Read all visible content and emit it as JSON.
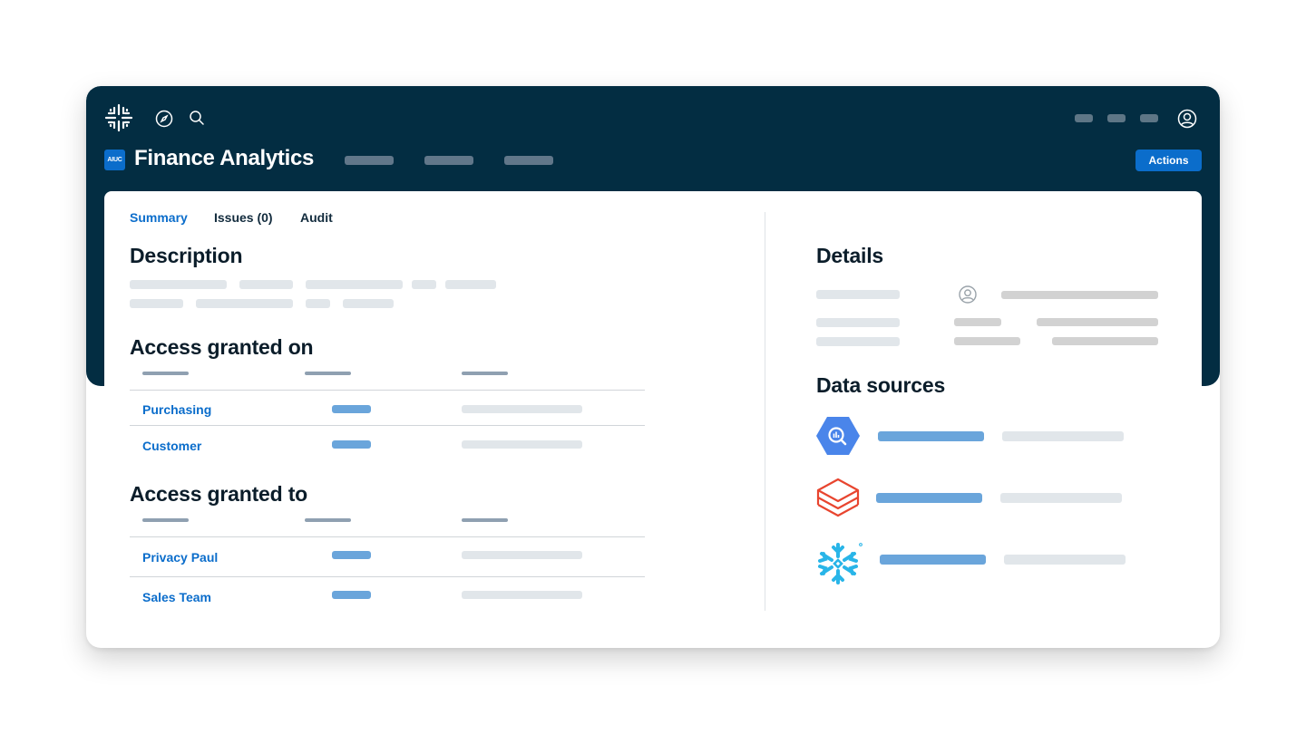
{
  "header": {
    "app_badge": "AIUC",
    "title": "Finance Analytics",
    "actions_label": "Actions"
  },
  "tabs": [
    {
      "label": "Summary",
      "active": true
    },
    {
      "label": "Issues (0)",
      "active": false
    },
    {
      "label": "Audit",
      "active": false
    }
  ],
  "sections": {
    "description_title": "Description",
    "access_on_title": "Access granted on",
    "access_to_title": "Access granted to",
    "details_title": "Details",
    "data_sources_title": "Data sources"
  },
  "access_granted_on": {
    "rows": [
      "Purchasing",
      "Customer"
    ]
  },
  "access_granted_to": {
    "rows": [
      "Privacy Paul",
      "Sales Team"
    ]
  },
  "data_sources": [
    {
      "icon": "bigquery-icon",
      "color": "#4a85ea"
    },
    {
      "icon": "databricks-icon",
      "color": "#e8452f"
    },
    {
      "icon": "snowflake-icon",
      "color": "#29b5e8"
    }
  ],
  "colors": {
    "header_bg": "#032d42",
    "accent": "#0b6dcb",
    "placeholder_blue": "#6aa5db",
    "placeholder_gray": "#e1e6ea"
  }
}
